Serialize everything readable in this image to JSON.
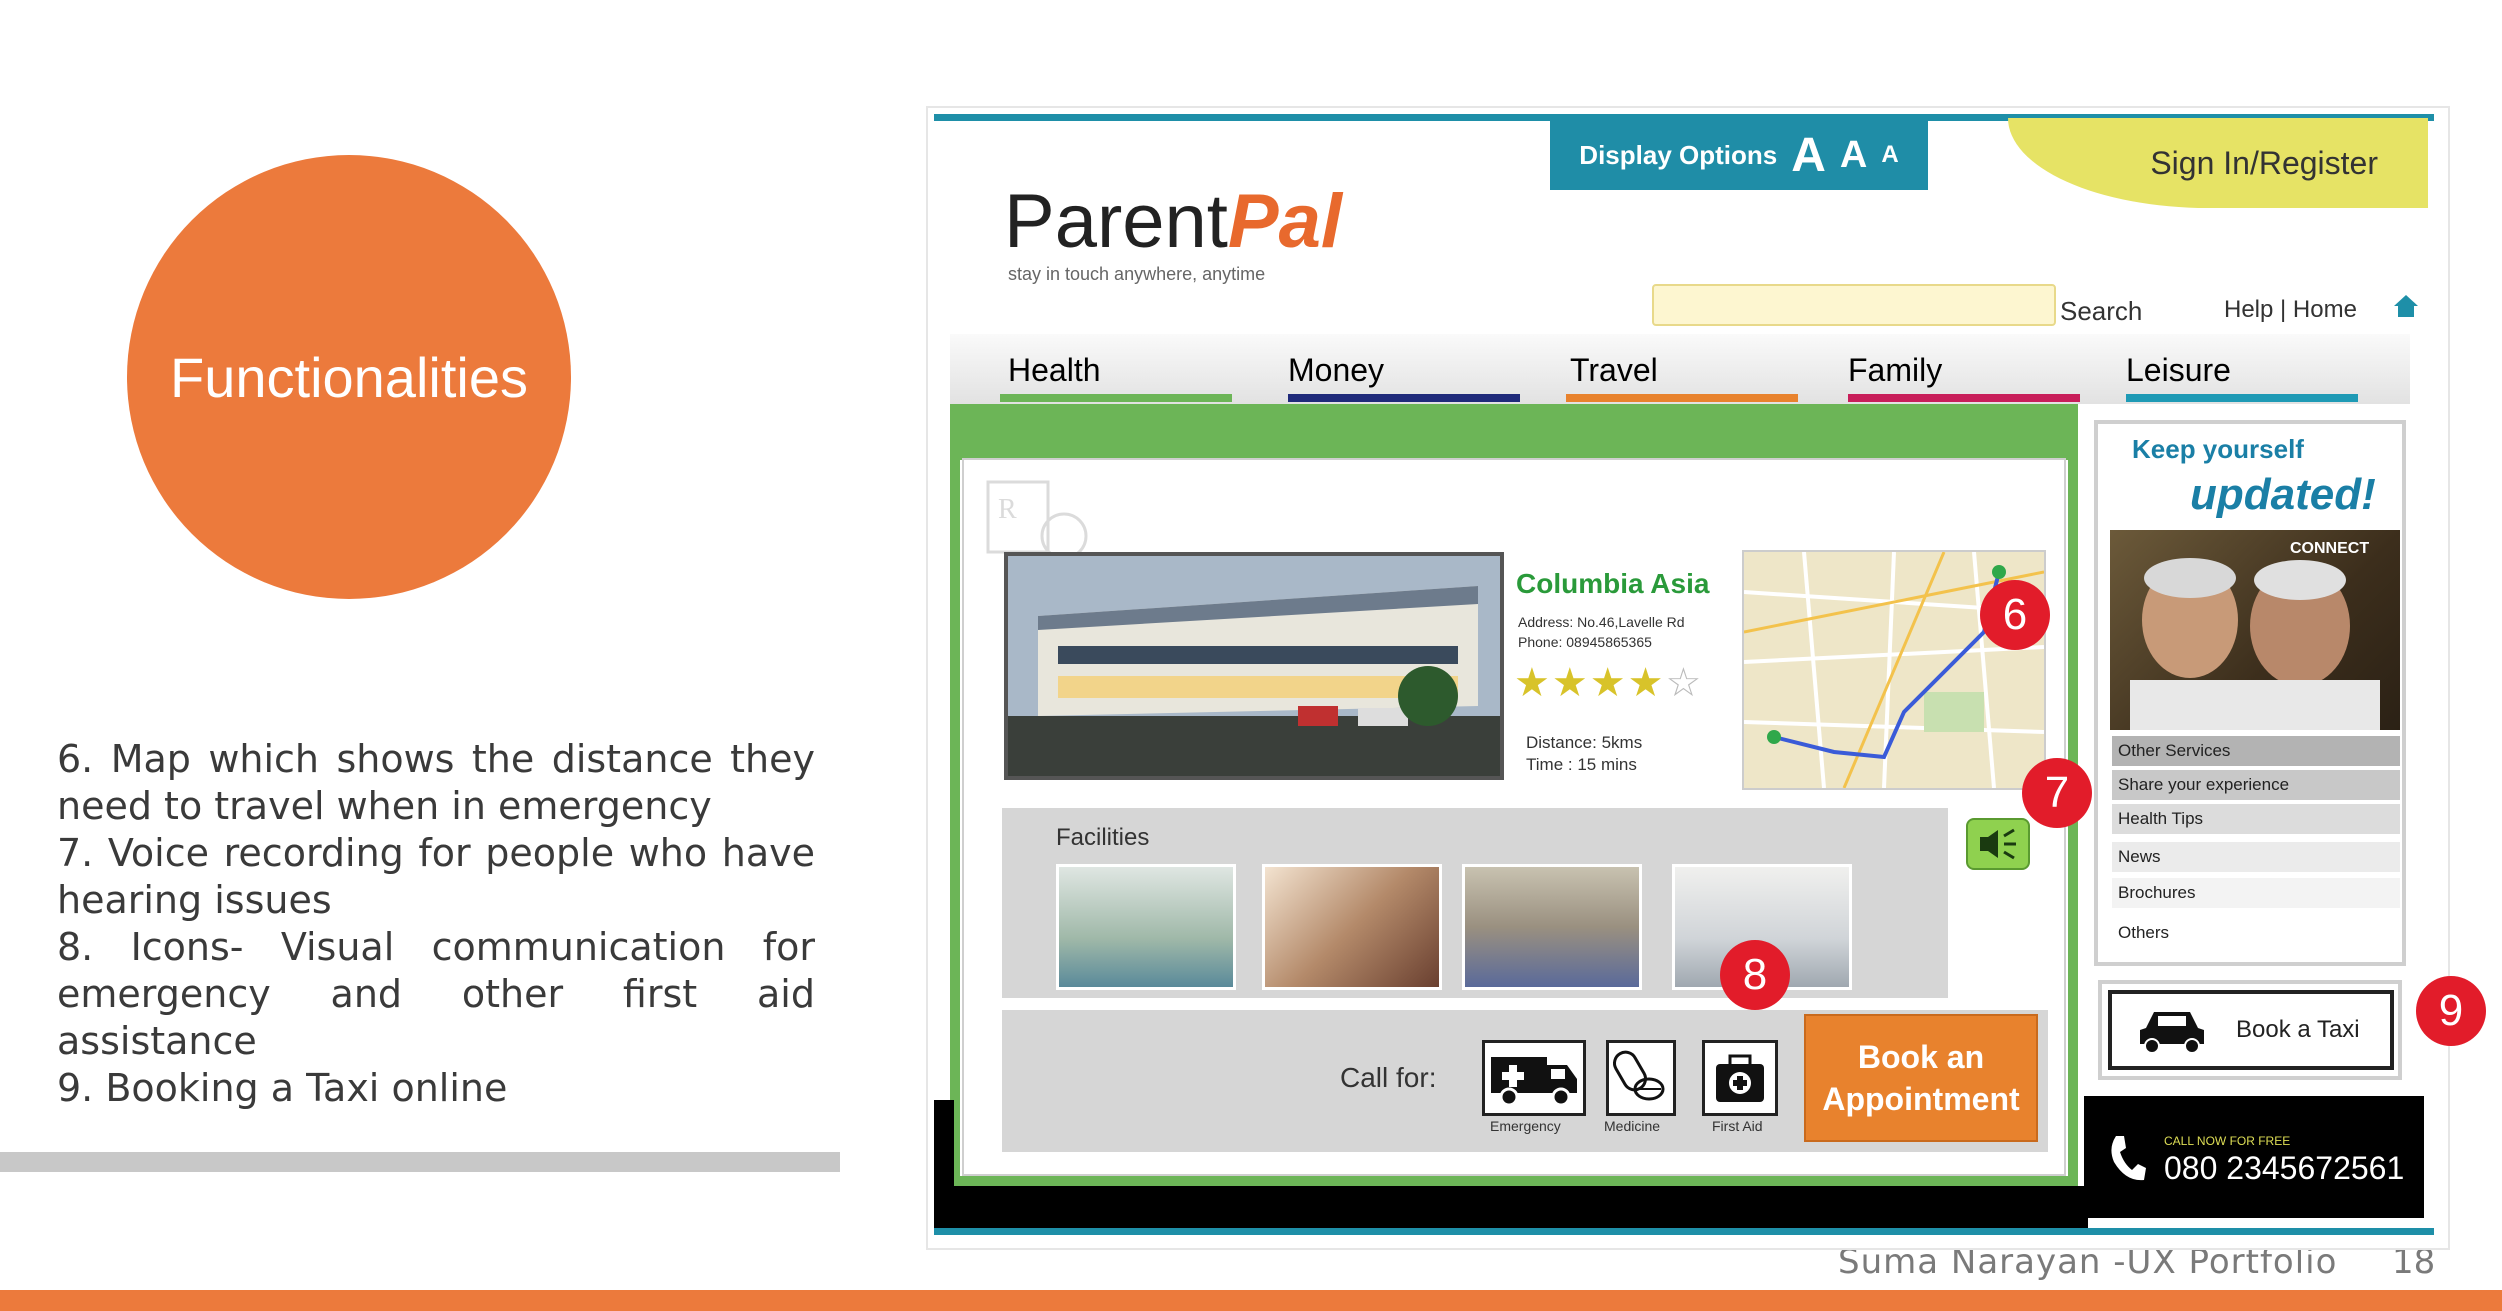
{
  "slide": {
    "title": "Functionalities",
    "notes": [
      "6. Map which shows the distance they need to travel when in emergency",
      "7. Voice recording for people who have hearing issues",
      "8. Icons- Visual communication for emergency and other first aid assistance",
      "9.   Booking a Taxi online"
    ],
    "footer": "Suma Narayan -UX Portfolio",
    "page_number": "18",
    "colors": {
      "accent": "#ec7a3c",
      "teal": "#1e8fa8",
      "green": "#6cb557"
    }
  },
  "app": {
    "display_options": {
      "label": "Display Options",
      "large": "A",
      "medium": "A",
      "small": "A"
    },
    "sign_in": "Sign In/Register",
    "logo": {
      "main": "Parent",
      "accent": "Pal",
      "tagline": "stay in touch anywhere, anytime"
    },
    "search": {
      "label": "Search",
      "value": ""
    },
    "help_home": "Help | Home",
    "tabs": [
      {
        "label": "Health",
        "color": "#2a8a3a"
      },
      {
        "label": "Money",
        "color": "#1f2a7a"
      },
      {
        "label": "Travel",
        "color": "#e8822d"
      },
      {
        "label": "Family",
        "color": "#c81e5a"
      },
      {
        "label": "Leisure",
        "color": "#1e9ab5"
      }
    ],
    "hospital": {
      "name": "Columbia Asia",
      "address": "Address: No.46,Lavelle Rd",
      "phone": "Phone: 08945865365",
      "rating": 4,
      "rating_max": 5,
      "distance": "Distance: 5kms",
      "time": "Time : 15 mins"
    },
    "facilities": {
      "label": "Facilities"
    },
    "call_for": {
      "label": "Call for:",
      "items": [
        {
          "caption": "Emergency",
          "icon": "ambulance-icon"
        },
        {
          "caption": "Medicine",
          "icon": "pills-icon"
        },
        {
          "caption": "First Aid",
          "icon": "first-aid-kit-icon"
        }
      ]
    },
    "book_appointment": {
      "line1": "Book an",
      "line2": "Appointment"
    },
    "sidebar": {
      "heading1": "Keep yourself",
      "heading2": "updated!",
      "connect": "CONNECT",
      "items": [
        "Other Services",
        "Share your experience",
        "Health Tips",
        "News",
        "Brochures",
        "Others"
      ]
    },
    "taxi": {
      "label": "Book a Taxi"
    },
    "call_now": {
      "small": "CALL NOW FOR FREE",
      "number": "080 2345672561"
    }
  },
  "markers": [
    "6",
    "7",
    "8",
    "9"
  ]
}
